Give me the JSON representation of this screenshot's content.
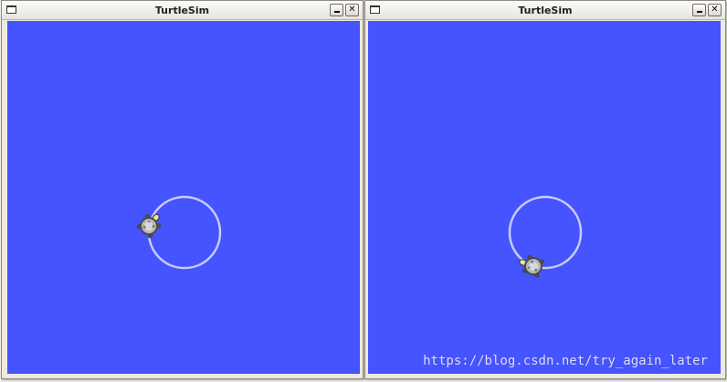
{
  "windows": [
    {
      "title": "TurtleSim",
      "minimize_glyph": "",
      "close_glyph": "✕"
    },
    {
      "title": "TurtleSim",
      "minimize_glyph": "",
      "close_glyph": "✕"
    }
  ],
  "canvas_color": "#4554ff",
  "trail_color": "#c8ccf5",
  "turtle": {
    "shell_color": "#b8b8b8",
    "edge_color": "#4a4a4a",
    "head_color": "#e6e6a8"
  },
  "watermark": "https://blog.csdn.net/try_again_later",
  "icons": [
    "window-menu-icon",
    "minimize-icon",
    "close-icon",
    "turtle-icon"
  ]
}
